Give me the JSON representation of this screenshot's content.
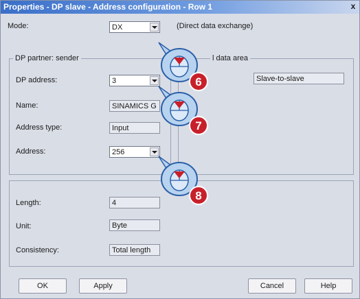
{
  "window": {
    "title": "Properties - DP slave - Address configuration - Row 1",
    "close_glyph": "x"
  },
  "mode": {
    "label": "Mode:",
    "value": "DX",
    "description": "(Direct data exchange)"
  },
  "sender_group": {
    "title": "DP partner: sender",
    "dp_address": {
      "label": "DP address:",
      "value": "3"
    },
    "name": {
      "label": "Name:",
      "value": "SINAMICS G"
    },
    "address_type": {
      "label": "Address type:",
      "value": "Input"
    },
    "address": {
      "label": "Address:",
      "value": "256"
    }
  },
  "data_area_group": {
    "title_fragment": "l data area",
    "value": "Slave-to-slave"
  },
  "bottom_group": {
    "length": {
      "label": "Length:",
      "value": "4"
    },
    "unit": {
      "label": "Unit:",
      "value": "Byte"
    },
    "consistency": {
      "label": "Consistency:",
      "value": "Total length"
    }
  },
  "buttons": {
    "ok": "OK",
    "apply": "Apply",
    "cancel": "Cancel",
    "help": "Help"
  },
  "callouts": [
    {
      "number": "6"
    },
    {
      "number": "7"
    },
    {
      "number": "8"
    }
  ],
  "colors": {
    "callout_fill": "#b8d3ef",
    "callout_stroke": "#2a5fa8",
    "marker": "#c8202a"
  }
}
